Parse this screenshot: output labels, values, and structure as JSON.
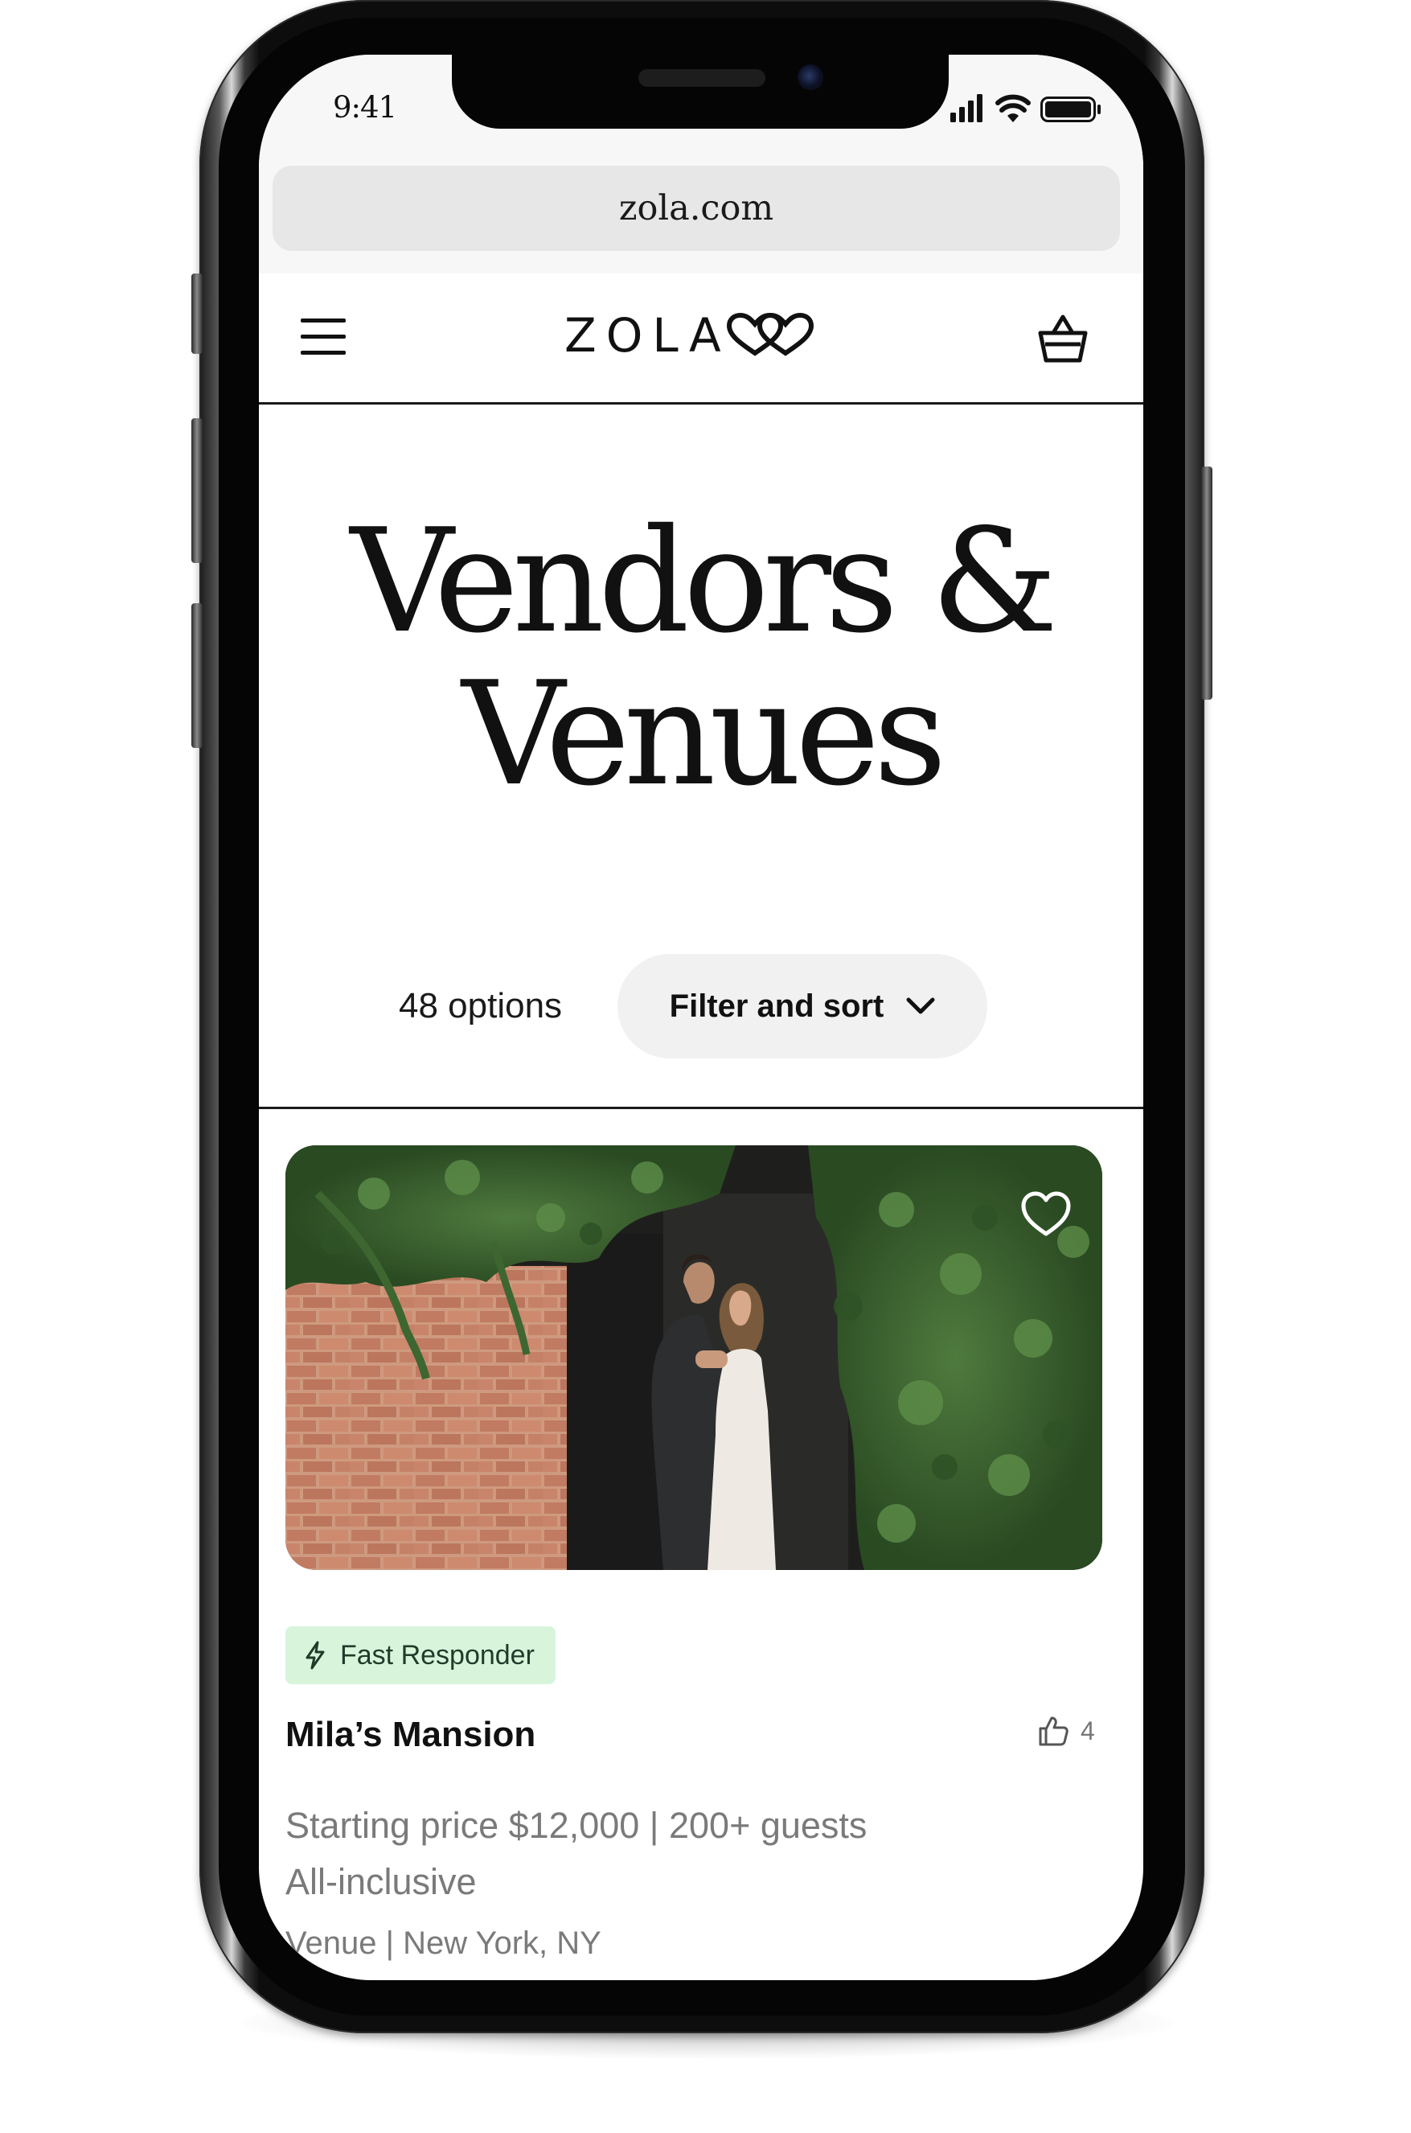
{
  "status_bar": {
    "time": "9:41",
    "icons": [
      "signal-bars-icon",
      "wifi-icon",
      "battery-icon"
    ]
  },
  "browser": {
    "url": "zola.com"
  },
  "header": {
    "logo_text": "ZOLA",
    "icons": [
      "hamburger-menu-icon",
      "double-heart-logo-icon",
      "shopping-basket-icon"
    ]
  },
  "page": {
    "title_line1": "Vendors &",
    "title_line2": "Venues",
    "options_count": "48 options",
    "filter_button_label": "Filter and sort"
  },
  "listing": {
    "badge_label": "Fast Responder",
    "name": "Mila’s Mansion",
    "likes": "4",
    "price_line": "Starting price $12,000 | 200+ guests",
    "package_line": "All-inclusive",
    "category_line": "Venue | New York, NY"
  },
  "colors": {
    "badge_bg": "#d8f5dc",
    "badge_text": "#1f3b2a",
    "filter_bg": "#f1f1f1",
    "muted_text": "#7a7a7a",
    "primary_text": "#111111"
  }
}
